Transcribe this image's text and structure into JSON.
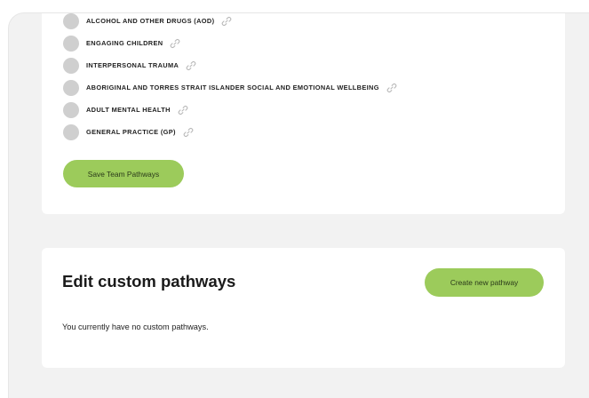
{
  "pathways": [
    {
      "label": "ALCOHOL AND OTHER DRUGS (AOD)"
    },
    {
      "label": "ENGAGING CHILDREN"
    },
    {
      "label": "INTERPERSONAL TRAUMA"
    },
    {
      "label": "ABORIGINAL AND TORRES STRAIT ISLANDER SOCIAL AND EMOTIONAL WELLBEING"
    },
    {
      "label": "ADULT MENTAL HEALTH"
    },
    {
      "label": "GENERAL PRACTICE (GP)"
    }
  ],
  "team_section": {
    "save_label": "Save Team Pathways"
  },
  "custom_section": {
    "title": "Edit custom pathways",
    "create_label": "Create new pathway",
    "empty_message": "You currently have no custom pathways."
  },
  "colors": {
    "accent": "#9ccb5b",
    "radio": "#cfcfcf",
    "page_bg": "#f2f2f2",
    "card_bg": "#ffffff"
  },
  "icons": {
    "pathway_link": "link-icon"
  }
}
